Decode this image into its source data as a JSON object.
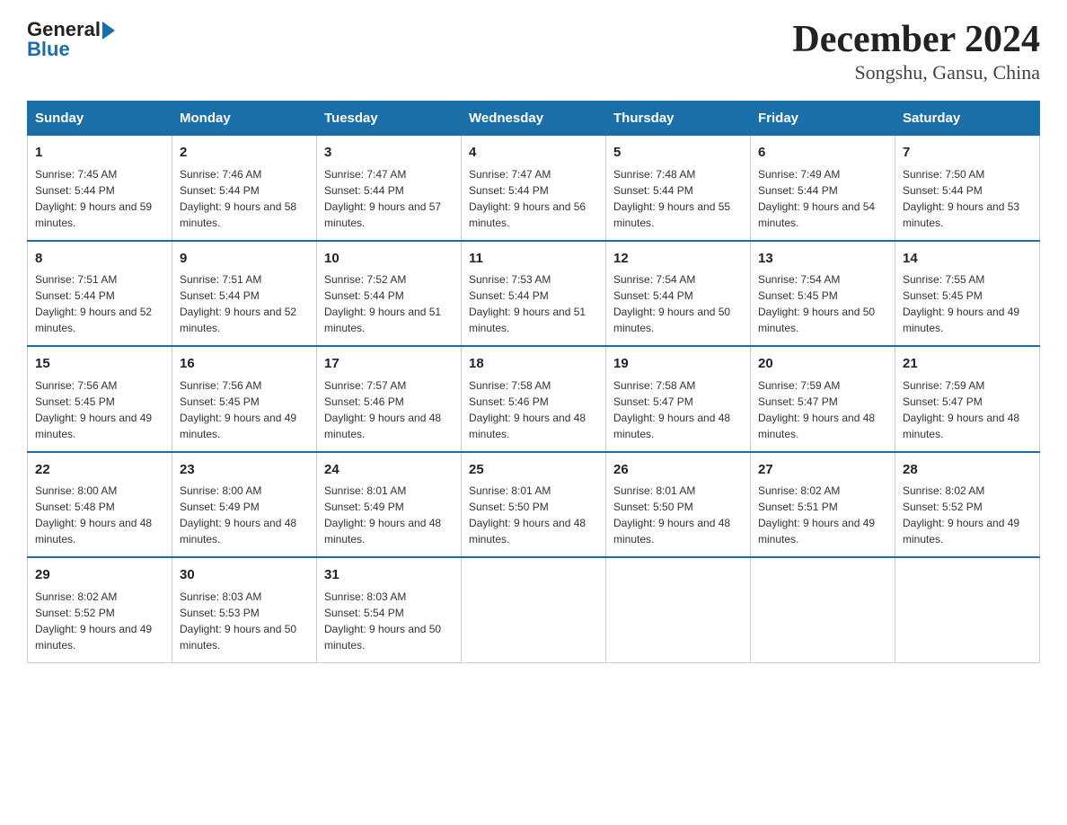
{
  "logo": {
    "general": "General",
    "blue": "Blue"
  },
  "title": "December 2024",
  "subtitle": "Songshu, Gansu, China",
  "headers": [
    "Sunday",
    "Monday",
    "Tuesday",
    "Wednesday",
    "Thursday",
    "Friday",
    "Saturday"
  ],
  "weeks": [
    [
      {
        "day": "1",
        "sunrise": "7:45 AM",
        "sunset": "5:44 PM",
        "daylight": "9 hours and 59 minutes."
      },
      {
        "day": "2",
        "sunrise": "7:46 AM",
        "sunset": "5:44 PM",
        "daylight": "9 hours and 58 minutes."
      },
      {
        "day": "3",
        "sunrise": "7:47 AM",
        "sunset": "5:44 PM",
        "daylight": "9 hours and 57 minutes."
      },
      {
        "day": "4",
        "sunrise": "7:47 AM",
        "sunset": "5:44 PM",
        "daylight": "9 hours and 56 minutes."
      },
      {
        "day": "5",
        "sunrise": "7:48 AM",
        "sunset": "5:44 PM",
        "daylight": "9 hours and 55 minutes."
      },
      {
        "day": "6",
        "sunrise": "7:49 AM",
        "sunset": "5:44 PM",
        "daylight": "9 hours and 54 minutes."
      },
      {
        "day": "7",
        "sunrise": "7:50 AM",
        "sunset": "5:44 PM",
        "daylight": "9 hours and 53 minutes."
      }
    ],
    [
      {
        "day": "8",
        "sunrise": "7:51 AM",
        "sunset": "5:44 PM",
        "daylight": "9 hours and 52 minutes."
      },
      {
        "day": "9",
        "sunrise": "7:51 AM",
        "sunset": "5:44 PM",
        "daylight": "9 hours and 52 minutes."
      },
      {
        "day": "10",
        "sunrise": "7:52 AM",
        "sunset": "5:44 PM",
        "daylight": "9 hours and 51 minutes."
      },
      {
        "day": "11",
        "sunrise": "7:53 AM",
        "sunset": "5:44 PM",
        "daylight": "9 hours and 51 minutes."
      },
      {
        "day": "12",
        "sunrise": "7:54 AM",
        "sunset": "5:44 PM",
        "daylight": "9 hours and 50 minutes."
      },
      {
        "day": "13",
        "sunrise": "7:54 AM",
        "sunset": "5:45 PM",
        "daylight": "9 hours and 50 minutes."
      },
      {
        "day": "14",
        "sunrise": "7:55 AM",
        "sunset": "5:45 PM",
        "daylight": "9 hours and 49 minutes."
      }
    ],
    [
      {
        "day": "15",
        "sunrise": "7:56 AM",
        "sunset": "5:45 PM",
        "daylight": "9 hours and 49 minutes."
      },
      {
        "day": "16",
        "sunrise": "7:56 AM",
        "sunset": "5:45 PM",
        "daylight": "9 hours and 49 minutes."
      },
      {
        "day": "17",
        "sunrise": "7:57 AM",
        "sunset": "5:46 PM",
        "daylight": "9 hours and 48 minutes."
      },
      {
        "day": "18",
        "sunrise": "7:58 AM",
        "sunset": "5:46 PM",
        "daylight": "9 hours and 48 minutes."
      },
      {
        "day": "19",
        "sunrise": "7:58 AM",
        "sunset": "5:47 PM",
        "daylight": "9 hours and 48 minutes."
      },
      {
        "day": "20",
        "sunrise": "7:59 AM",
        "sunset": "5:47 PM",
        "daylight": "9 hours and 48 minutes."
      },
      {
        "day": "21",
        "sunrise": "7:59 AM",
        "sunset": "5:47 PM",
        "daylight": "9 hours and 48 minutes."
      }
    ],
    [
      {
        "day": "22",
        "sunrise": "8:00 AM",
        "sunset": "5:48 PM",
        "daylight": "9 hours and 48 minutes."
      },
      {
        "day": "23",
        "sunrise": "8:00 AM",
        "sunset": "5:49 PM",
        "daylight": "9 hours and 48 minutes."
      },
      {
        "day": "24",
        "sunrise": "8:01 AM",
        "sunset": "5:49 PM",
        "daylight": "9 hours and 48 minutes."
      },
      {
        "day": "25",
        "sunrise": "8:01 AM",
        "sunset": "5:50 PM",
        "daylight": "9 hours and 48 minutes."
      },
      {
        "day": "26",
        "sunrise": "8:01 AM",
        "sunset": "5:50 PM",
        "daylight": "9 hours and 48 minutes."
      },
      {
        "day": "27",
        "sunrise": "8:02 AM",
        "sunset": "5:51 PM",
        "daylight": "9 hours and 49 minutes."
      },
      {
        "day": "28",
        "sunrise": "8:02 AM",
        "sunset": "5:52 PM",
        "daylight": "9 hours and 49 minutes."
      }
    ],
    [
      {
        "day": "29",
        "sunrise": "8:02 AM",
        "sunset": "5:52 PM",
        "daylight": "9 hours and 49 minutes."
      },
      {
        "day": "30",
        "sunrise": "8:03 AM",
        "sunset": "5:53 PM",
        "daylight": "9 hours and 50 minutes."
      },
      {
        "day": "31",
        "sunrise": "8:03 AM",
        "sunset": "5:54 PM",
        "daylight": "9 hours and 50 minutes."
      },
      null,
      null,
      null,
      null
    ]
  ],
  "cell_labels": {
    "sunrise": "Sunrise: ",
    "sunset": "Sunset: ",
    "daylight": "Daylight: "
  }
}
